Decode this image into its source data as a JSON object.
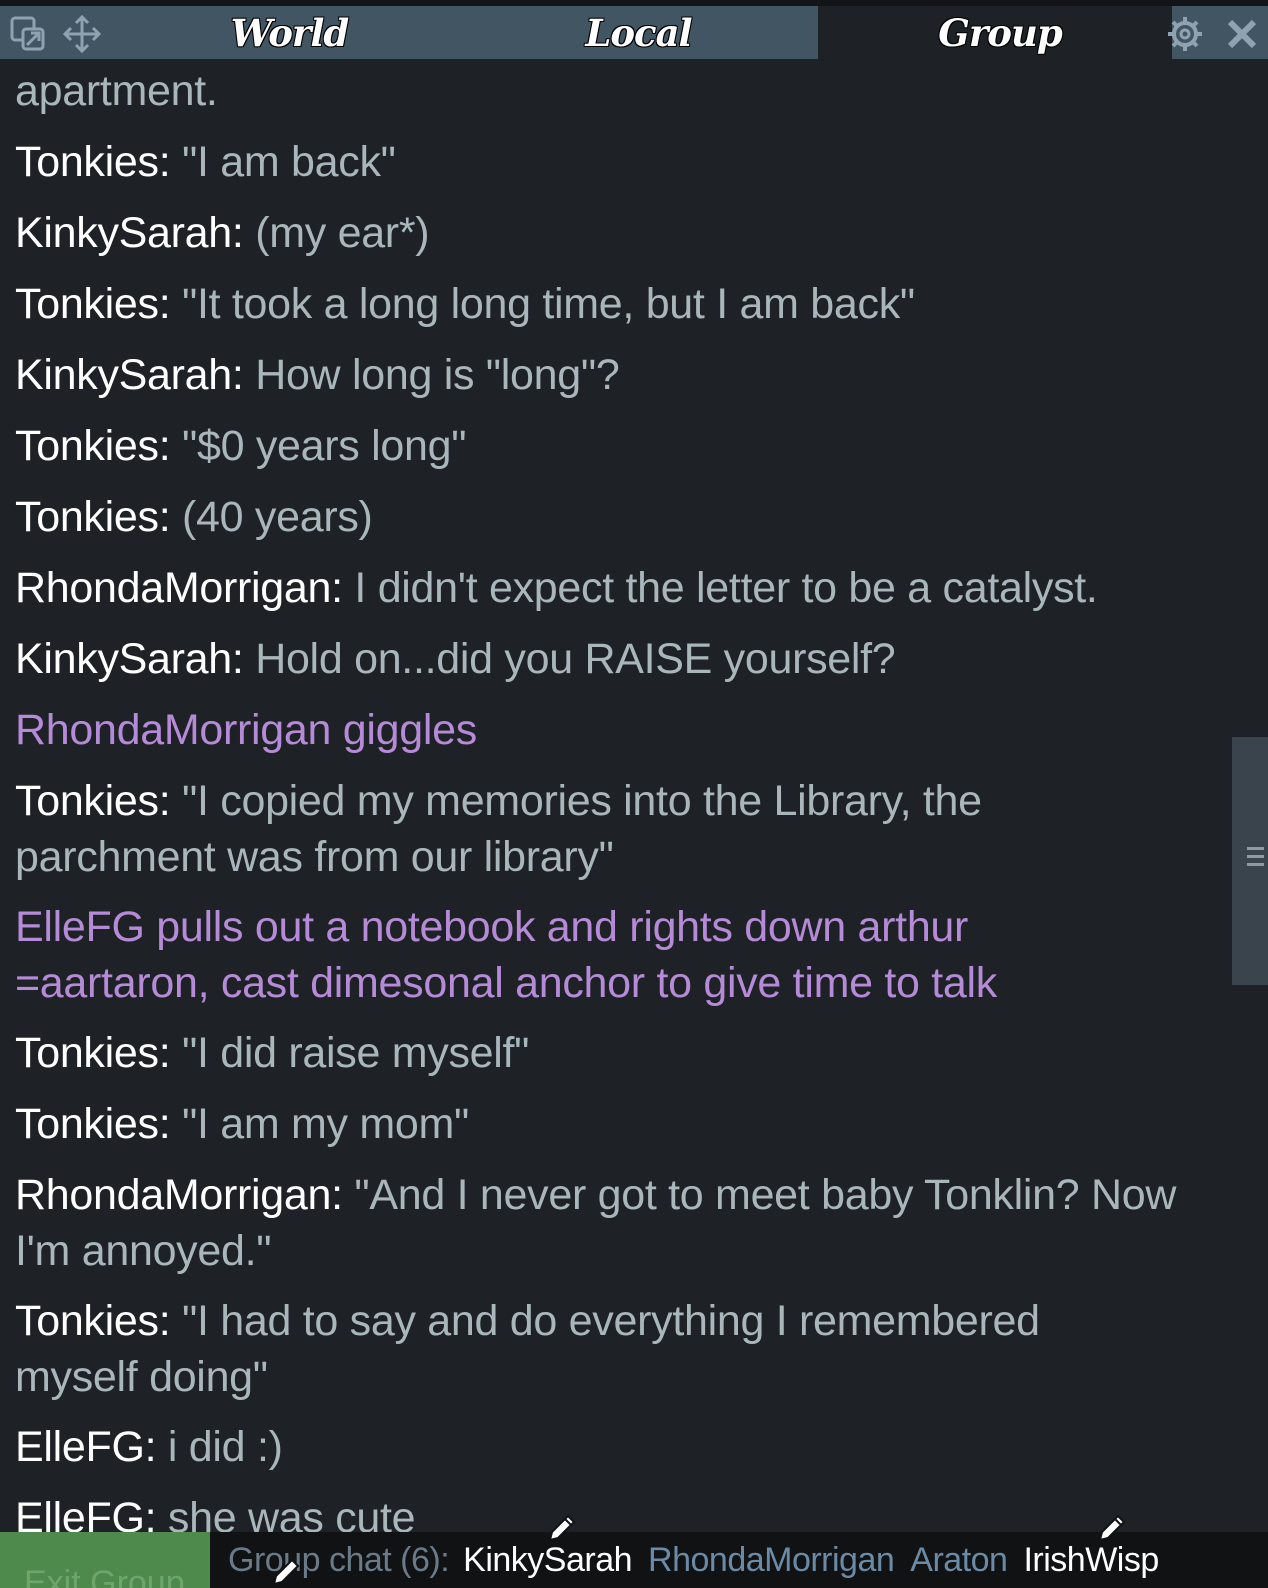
{
  "tabs": {
    "world": "World",
    "local": "Local",
    "group": "Group"
  },
  "icons": {
    "popout": "popout-icon",
    "move": "move-icon",
    "settings": "gear-icon",
    "close": "close-icon",
    "edit": "pencil-icon"
  },
  "messages": [
    {
      "type": "plain",
      "text": "apartment."
    },
    {
      "type": "say",
      "speaker": "Tonkies:",
      "text": " \"I am back\""
    },
    {
      "type": "say",
      "speaker": "KinkySarah:",
      "text": " (my ear*)"
    },
    {
      "type": "say",
      "speaker": "Tonkies:",
      "text": " \"It took a long long time, but I am back\""
    },
    {
      "type": "say",
      "speaker": "KinkySarah:",
      "text": " How long is \"long\"?"
    },
    {
      "type": "say",
      "speaker": "Tonkies:",
      "text": " \"$0 years long\""
    },
    {
      "type": "say",
      "speaker": "Tonkies:",
      "text": " (40 years)"
    },
    {
      "type": "say",
      "speaker": "RhondaMorrigan:",
      "text": " I didn't expect the letter to be a catalyst."
    },
    {
      "type": "say",
      "speaker": "KinkySarah:",
      "text": " Hold on...did you RAISE yourself?"
    },
    {
      "type": "emote",
      "text": "RhondaMorrigan giggles"
    },
    {
      "type": "say",
      "speaker": "Tonkies:",
      "text": " \"I copied my memories into the Library, the parchment was from our library\""
    },
    {
      "type": "emote",
      "text": "ElleFG pulls out a notebook and rights down arthur =aartaron, cast dimesonal anchor to give time to talk"
    },
    {
      "type": "say",
      "speaker": "Tonkies:",
      "text": " \"I did raise myself\""
    },
    {
      "type": "say",
      "speaker": "Tonkies:",
      "text": " \"I am my mom\""
    },
    {
      "type": "say",
      "speaker": "RhondaMorrigan:",
      "text": " \"And I never got to meet baby Tonklin? Now I'm annoyed.\""
    },
    {
      "type": "say",
      "speaker": "Tonkies:",
      "text": " \"I had to say and do everything I remembered myself doing\""
    },
    {
      "type": "say",
      "speaker": "ElleFG:",
      "text": " i did :)"
    },
    {
      "type": "say",
      "speaker": "ElleFG:",
      "text": " she was cute"
    }
  ],
  "bottom": {
    "exit_label": "Exit Group",
    "members_label": "Group chat (6):",
    "members": [
      {
        "name": "KinkySarah",
        "active": true
      },
      {
        "name": "RhondaMorrigan",
        "active": false
      },
      {
        "name": "Araton",
        "active": false
      },
      {
        "name": "IrishWisp",
        "active": true
      }
    ]
  },
  "colors": {
    "background": "#1e2226",
    "tab_inactive": "#425563",
    "speaker": "#ffffff",
    "message_text": "#a9b6bc",
    "emote": "#b58ad6",
    "exit_button": "#4d8a4b",
    "member_inactive": "#6b8aa5"
  }
}
